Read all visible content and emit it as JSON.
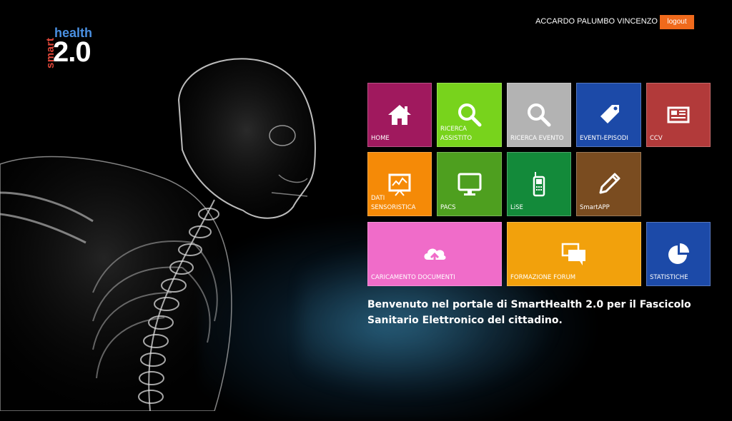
{
  "logo": {
    "smart": "smart",
    "health": "health",
    "version": "2.0"
  },
  "header": {
    "user_name": "ACCARDO PALUMBO VINCENZO",
    "logout_label": "logout"
  },
  "tiles": [
    {
      "label": "HOME",
      "color": "#a0195e",
      "icon": "home-icon"
    },
    {
      "label": "RICERCA ASSISTITO",
      "color": "#78d31c",
      "icon": "search-icon"
    },
    {
      "label": "RICERCA EVENTO",
      "color": "#b3b3b3",
      "icon": "search-icon"
    },
    {
      "label": "EVENTI-EPISODI",
      "color": "#1c4aa8",
      "icon": "tag-icon"
    },
    {
      "label": "CCV",
      "color": "#b23a3a",
      "icon": "newspaper-icon"
    },
    {
      "label": "DATI SENSORISTICA",
      "color": "#f58a07",
      "icon": "chart-board-icon"
    },
    {
      "label": "PACS",
      "color": "#4e9f1f",
      "icon": "monitor-icon"
    },
    {
      "label": "LiSE",
      "color": "#138a3a",
      "icon": "mobile-phone-icon"
    },
    {
      "label": "SmartAPP",
      "color": "#7a4c20",
      "icon": "pencil-icon"
    },
    {
      "label": "CARICAMENTO DOCUMENTI",
      "color": "#f06cc9",
      "icon": "cloud-upload-icon"
    },
    {
      "label": "FORMAZIONE FORUM",
      "color": "#f2a10c",
      "icon": "chat-bubbles-icon"
    },
    {
      "label": "STATISTICHE",
      "color": "#1c4aa8",
      "icon": "pie-chart-icon"
    }
  ],
  "welcome": {
    "line1": "Benvenuto nel portale di SmartHealth 2.0 per il Fascicolo",
    "line2": "Sanitario Elettronico del cittadino."
  }
}
